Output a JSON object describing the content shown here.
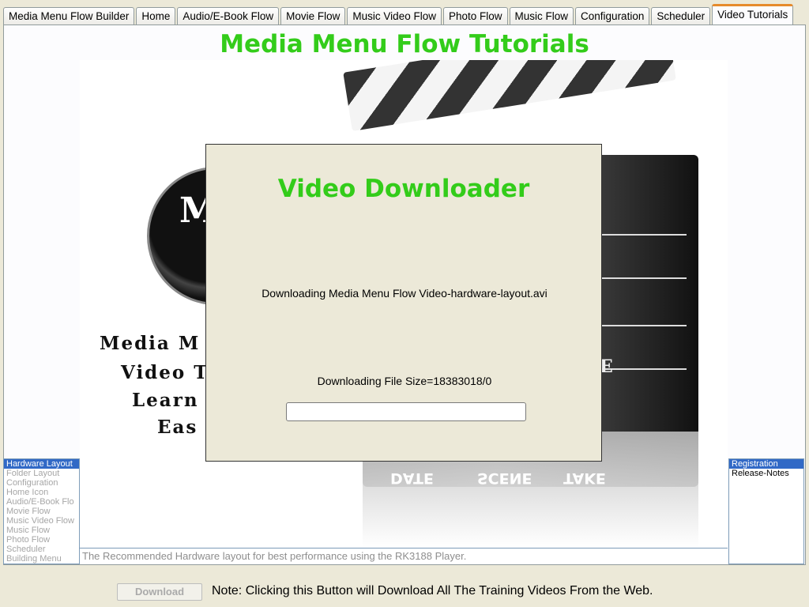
{
  "tabs": [
    {
      "label": "Media Menu Flow Builder",
      "active": false
    },
    {
      "label": "Home",
      "active": false
    },
    {
      "label": "Audio/E-Book Flow",
      "active": false
    },
    {
      "label": "Movie Flow",
      "active": false
    },
    {
      "label": "Music Video Flow",
      "active": false
    },
    {
      "label": "Photo Flow",
      "active": false
    },
    {
      "label": "Music Flow",
      "active": false
    },
    {
      "label": "Configuration",
      "active": false
    },
    {
      "label": "Scheduler",
      "active": false
    },
    {
      "label": "Video Tutorials",
      "active": true
    }
  ],
  "page": {
    "title": "Media Menu Flow Tutorials"
  },
  "hero": {
    "logo_letter": "M",
    "slogan": [
      "Media M",
      "Video T",
      "Learn",
      "Eas"
    ],
    "board_letter": "E",
    "reflection": [
      "DATE",
      "SCENE",
      "TAKE"
    ]
  },
  "left_list": {
    "selected": 0,
    "items": [
      "Hardware Layout",
      "Folder Layout",
      "Configuration",
      "Home Icon",
      "Audio/E-Book Flo",
      "Movie Flow",
      "Music Video Flow",
      "Music Flow",
      "Photo Flow",
      "Scheduler",
      "Building Menu"
    ]
  },
  "right_list": {
    "selected": 0,
    "items": [
      "Registration",
      "Release-Notes"
    ]
  },
  "description": "The Recommended Hardware layout for best performance using the RK3188 Player.",
  "bottom": {
    "download_label": "Download",
    "note": "Note: Clicking this Button will Download All The Training Videos From the Web."
  },
  "modal": {
    "title": "Video Downloader",
    "downloading_text": "Downloading Media Menu Flow Video-hardware-layout.avi",
    "size_text": "Downloading File Size=18383018/0",
    "progress": 0
  },
  "colors": {
    "accent_green": "#33cc1a",
    "selection_blue": "#3169c6",
    "active_tab_top": "#e68b2c"
  }
}
